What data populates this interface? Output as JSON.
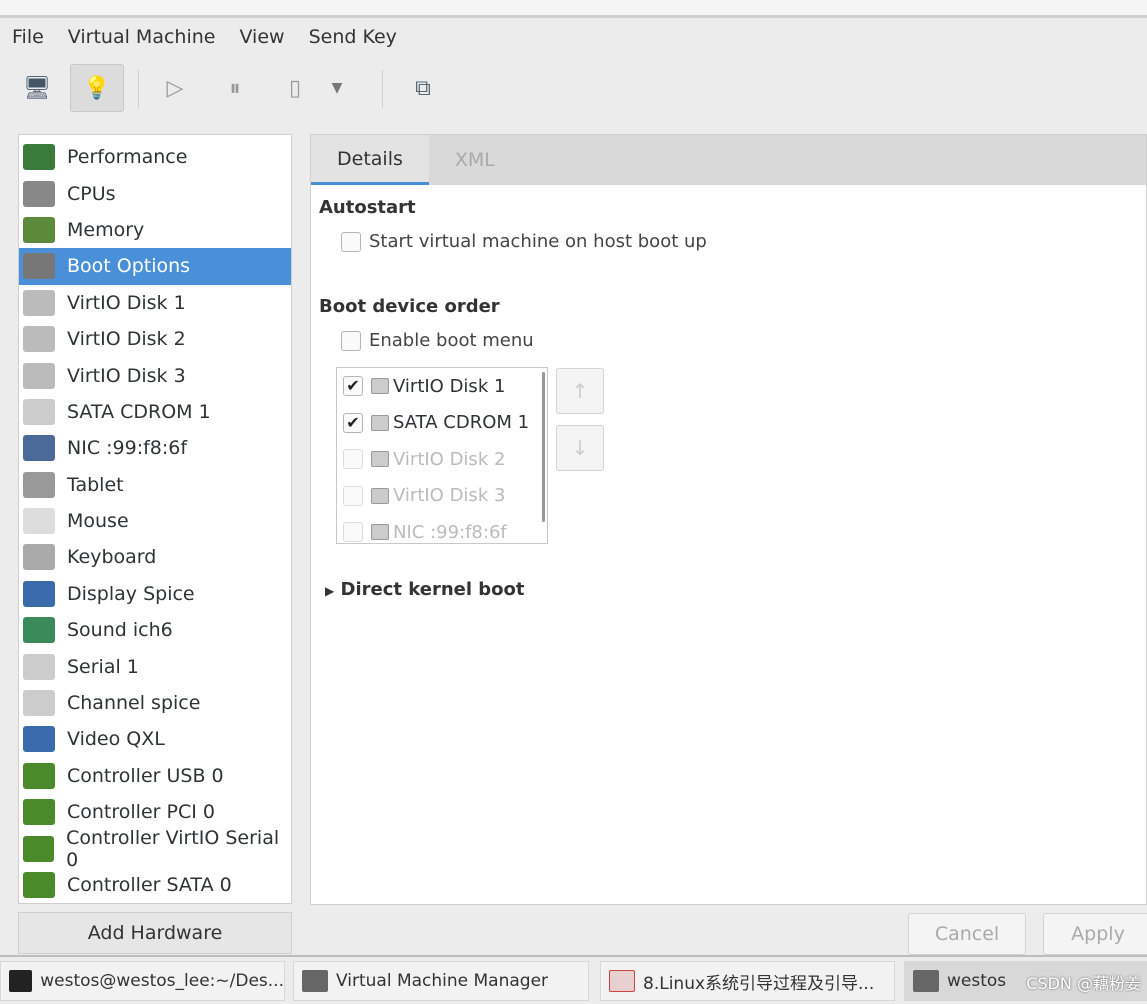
{
  "menu": [
    "File",
    "Virtual Machine",
    "View",
    "Send Key"
  ],
  "toolbar": {
    "icons": [
      "monitor-icon",
      "lightbulb-icon",
      "play-icon",
      "pause-icon",
      "power-icon",
      "dropdown-icon",
      "screens-icon"
    ]
  },
  "sidebar": {
    "items": [
      {
        "label": "Performance",
        "icon": "performance-icon",
        "color": "#3a7a3a"
      },
      {
        "label": "CPUs",
        "icon": "cpu-icon",
        "color": "#888"
      },
      {
        "label": "Memory",
        "icon": "memory-icon",
        "color": "#5a8a3a"
      },
      {
        "label": "Boot Options",
        "icon": "gears-icon",
        "color": "#777",
        "selected": true
      },
      {
        "label": "VirtIO Disk 1",
        "icon": "disk-icon",
        "color": "#bbb"
      },
      {
        "label": "VirtIO Disk 2",
        "icon": "disk-icon",
        "color": "#bbb"
      },
      {
        "label": "VirtIO Disk 3",
        "icon": "disk-icon",
        "color": "#bbb"
      },
      {
        "label": "SATA CDROM 1",
        "icon": "cdrom-icon",
        "color": "#ccc"
      },
      {
        "label": "NIC :99:f8:6f",
        "icon": "nic-icon",
        "color": "#4a6a9a"
      },
      {
        "label": "Tablet",
        "icon": "tablet-icon",
        "color": "#999"
      },
      {
        "label": "Mouse",
        "icon": "mouse-icon",
        "color": "#ddd"
      },
      {
        "label": "Keyboard",
        "icon": "keyboard-icon",
        "color": "#aaa"
      },
      {
        "label": "Display Spice",
        "icon": "display-icon",
        "color": "#3a6aaa"
      },
      {
        "label": "Sound ich6",
        "icon": "sound-icon",
        "color": "#3a8a5a"
      },
      {
        "label": "Serial 1",
        "icon": "serial-icon",
        "color": "#ccc"
      },
      {
        "label": "Channel spice",
        "icon": "channel-icon",
        "color": "#ccc"
      },
      {
        "label": "Video QXL",
        "icon": "video-icon",
        "color": "#3a6aaa"
      },
      {
        "label": "Controller USB 0",
        "icon": "controller-icon",
        "color": "#4a8a2a"
      },
      {
        "label": "Controller PCI 0",
        "icon": "controller-icon",
        "color": "#4a8a2a"
      },
      {
        "label": "Controller VirtIO Serial 0",
        "icon": "controller-icon",
        "color": "#4a8a2a"
      },
      {
        "label": "Controller SATA 0",
        "icon": "controller-icon",
        "color": "#4a8a2a"
      }
    ]
  },
  "add_hardware": "Add Hardware",
  "tabs": [
    "Details",
    "XML"
  ],
  "autostart": {
    "title": "Autostart",
    "label": "Start virtual machine on host boot up",
    "checked": false
  },
  "boot": {
    "title": "Boot device order",
    "menu_label": "Enable boot menu",
    "menu_checked": false,
    "devices": [
      {
        "label": "VirtIO Disk 1",
        "checked": true
      },
      {
        "label": "SATA CDROM 1",
        "checked": true
      },
      {
        "label": "VirtIO Disk 2",
        "checked": false
      },
      {
        "label": "VirtIO Disk 3",
        "checked": false
      },
      {
        "label": "NIC :99:f8:6f",
        "checked": false
      }
    ]
  },
  "kernel": "Direct kernel boot",
  "buttons": {
    "cancel": "Cancel",
    "apply": "Apply"
  },
  "taskbar": [
    "westos@westos_lee:~/Des...",
    "Virtual Machine Manager",
    "8.Linux系统引导过程及引导...",
    "westos"
  ],
  "watermark": "CSDN @藕粉姜",
  "accent": "#4a90d9"
}
